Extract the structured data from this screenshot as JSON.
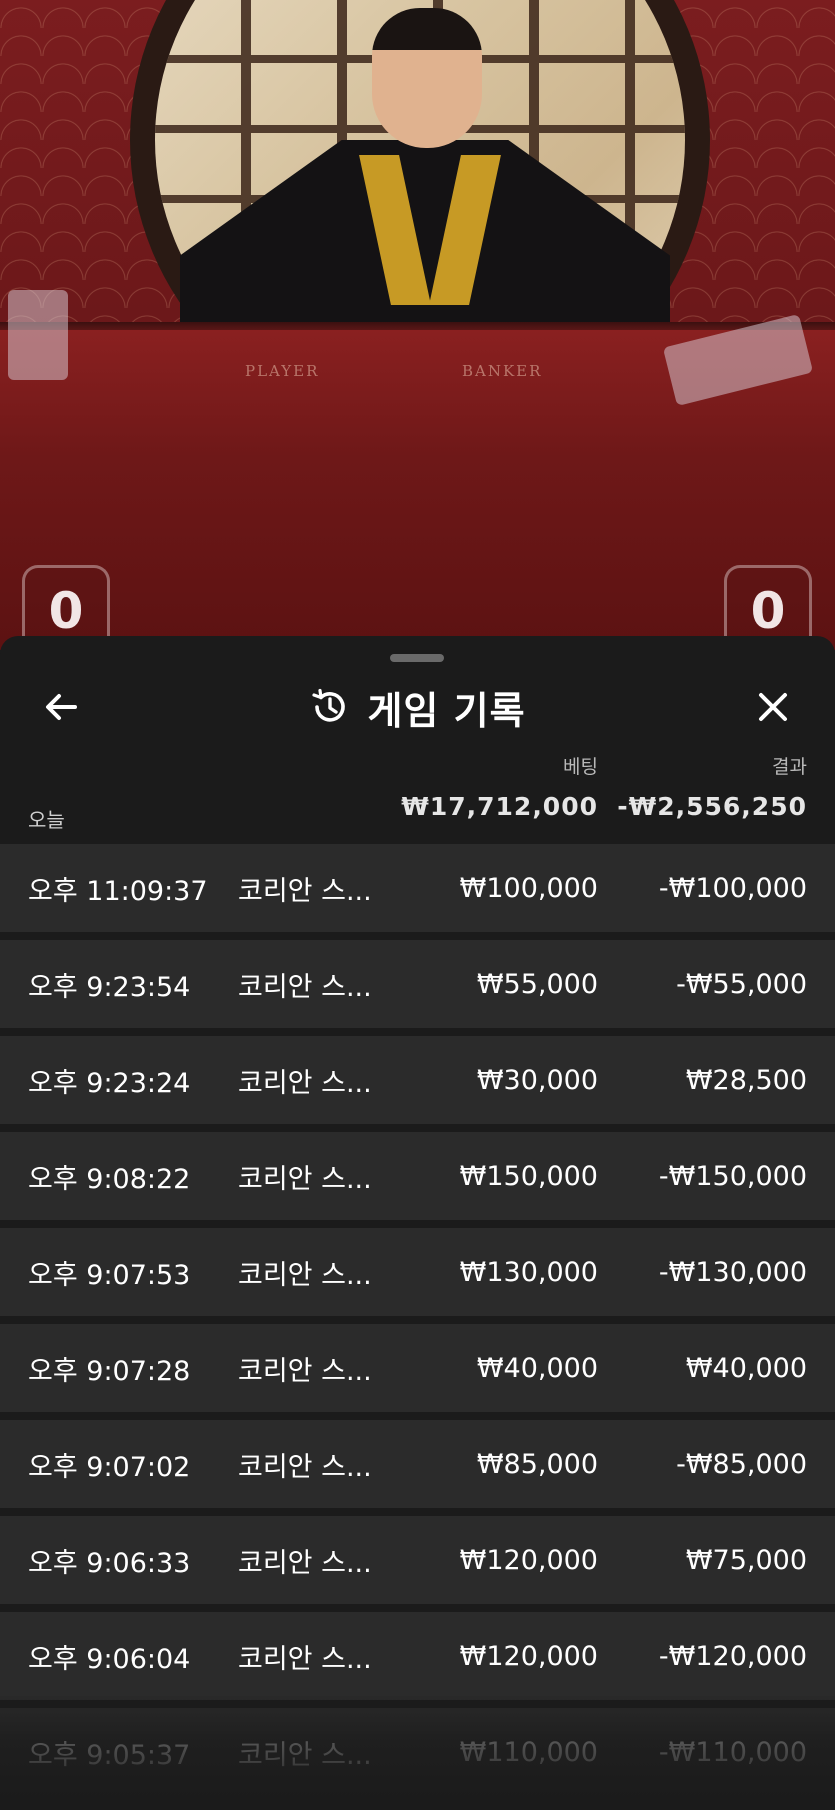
{
  "video": {
    "table_labels": [
      "PLAYER",
      "BANKER"
    ],
    "player_score": "0",
    "banker_score": "0"
  },
  "panel": {
    "title": "게임 기록",
    "icons": {
      "back": "back-arrow-icon",
      "history": "history-icon",
      "close": "close-icon"
    },
    "columns": {
      "bet": "베팅",
      "result": "결과"
    },
    "summary": {
      "day_label": "오늘",
      "total_bet": "₩17,712,000",
      "total_result": "-₩2,556,250"
    },
    "rows": [
      {
        "time": "오후 11:09:37",
        "game": "코리안 스...",
        "bet": "₩100,000",
        "result": "-₩100,000"
      },
      {
        "time": "오후 9:23:54",
        "game": "코리안 스...",
        "bet": "₩55,000",
        "result": "-₩55,000"
      },
      {
        "time": "오후 9:23:24",
        "game": "코리안 스...",
        "bet": "₩30,000",
        "result": "₩28,500"
      },
      {
        "time": "오후 9:08:22",
        "game": "코리안 스...",
        "bet": "₩150,000",
        "result": "-₩150,000"
      },
      {
        "time": "오후 9:07:53",
        "game": "코리안 스...",
        "bet": "₩130,000",
        "result": "-₩130,000"
      },
      {
        "time": "오후 9:07:28",
        "game": "코리안 스...",
        "bet": "₩40,000",
        "result": "₩40,000"
      },
      {
        "time": "오후 9:07:02",
        "game": "코리안 스...",
        "bet": "₩85,000",
        "result": "-₩85,000"
      },
      {
        "time": "오후 9:06:33",
        "game": "코리안 스...",
        "bet": "₩120,000",
        "result": "₩75,000"
      },
      {
        "time": "오후 9:06:04",
        "game": "코리안 스...",
        "bet": "₩120,000",
        "result": "-₩120,000"
      },
      {
        "time": "오후 9:05:37",
        "game": "코리안 스...",
        "bet": "₩110,000",
        "result": "-₩110,000"
      }
    ]
  }
}
